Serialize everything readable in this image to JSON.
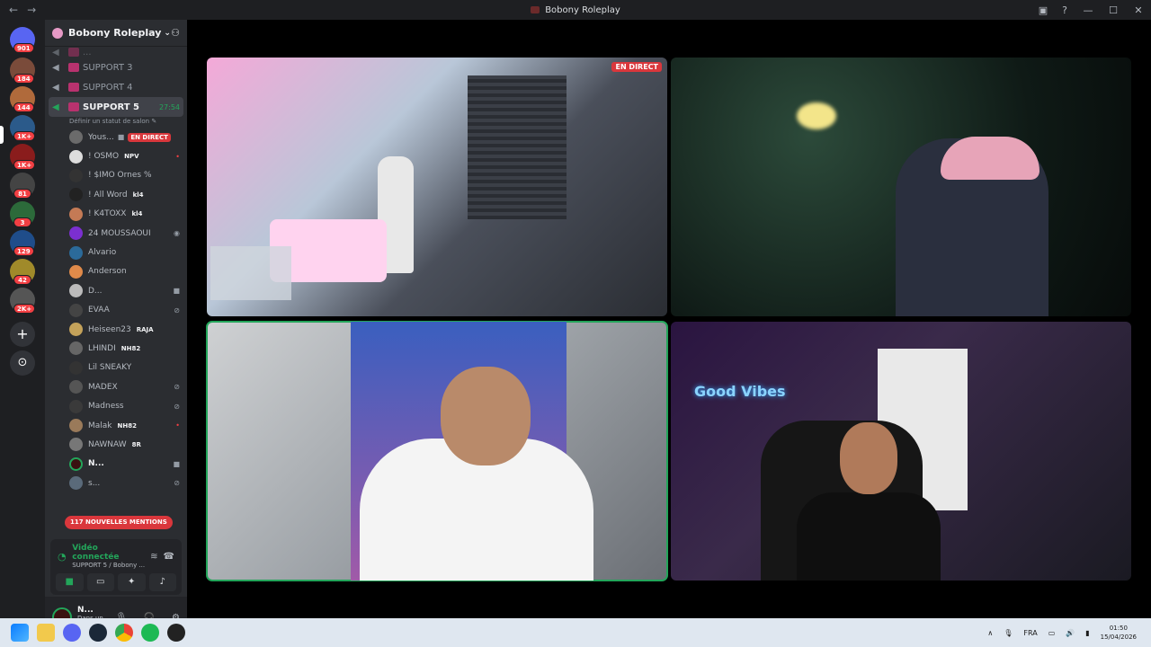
{
  "window": {
    "title": "Bobony Roleplay",
    "back_icon": "arrow-left-icon",
    "forward_icon": "arrow-right-icon"
  },
  "guilds": [
    {
      "name": "discord-home",
      "badge": "901",
      "color": "#5865f2"
    },
    {
      "name": "guild-1",
      "badge": "184",
      "color": "#7a4b3a"
    },
    {
      "name": "guild-2",
      "badge": "144",
      "color": "#b06a3b"
    },
    {
      "name": "guild-3",
      "badge": "1K+",
      "color": "#2b5a8a"
    },
    {
      "name": "guild-4",
      "badge": "1K+",
      "color": "#8a1c1c"
    },
    {
      "name": "guild-5",
      "badge": "81",
      "color": "#444"
    },
    {
      "name": "guild-6",
      "badge": "3",
      "color": "#2c6a3a"
    },
    {
      "name": "guild-7",
      "badge": "129",
      "color": "#1f4d8a"
    },
    {
      "name": "guild-8",
      "badge": "42",
      "color": "#a08a2a"
    },
    {
      "name": "guild-9",
      "badge": "2K+",
      "color": "#555"
    }
  ],
  "server": {
    "name": "Bobony Roleplay",
    "channels": [
      {
        "label": "SUPPORT 3"
      },
      {
        "label": "SUPPORT 4"
      }
    ],
    "active_channel": {
      "label": "SUPPORT 5",
      "time": "27:54",
      "subtitle": "Définir un statut de salon"
    },
    "members": [
      {
        "name": "Yous...",
        "extra": "",
        "live": "EN DIRECT",
        "color": "#6b6b6b"
      },
      {
        "name": "! OSMO",
        "extra": "NPV",
        "live": "",
        "color": "#ddd"
      },
      {
        "name": "! $IMO Ornes %",
        "extra": "",
        "live": "",
        "color": "#333"
      },
      {
        "name": "! All Word",
        "extra": "kl4",
        "live": "",
        "color": "#222"
      },
      {
        "name": "! K4TOXX",
        "extra": "kl4",
        "live": "",
        "color": "#c47a55"
      },
      {
        "name": "24 MOUSSAOUI",
        "extra": "",
        "live": "",
        "color": "#7b2fd0"
      },
      {
        "name": "Alvario",
        "extra": "",
        "live": "",
        "color": "#2b6a9a"
      },
      {
        "name": "Anderson",
        "extra": "",
        "live": "",
        "color": "#e08a4a"
      },
      {
        "name": "D...",
        "extra": "",
        "live": "",
        "color": "#bbb"
      },
      {
        "name": "EVAA",
        "extra": "",
        "live": "",
        "color": "#444"
      },
      {
        "name": "Heiseen23",
        "extra": "RAJA",
        "live": "",
        "color": "#c4a25a"
      },
      {
        "name": "LHINDI",
        "extra": "NH82",
        "live": "",
        "color": "#666"
      },
      {
        "name": "Lil SNEAKY",
        "extra": "",
        "live": "",
        "color": "#333"
      },
      {
        "name": "MADEX",
        "extra": "",
        "live": "",
        "color": "#555"
      },
      {
        "name": "Madness",
        "extra": "",
        "live": "",
        "color": "#3a3a3a"
      },
      {
        "name": "Malak",
        "extra": "NH82",
        "live": "",
        "color": "#9a7a5a"
      },
      {
        "name": "NAWNAW",
        "extra": "8R",
        "live": "",
        "color": "#777"
      },
      {
        "name": "N...",
        "extra": "",
        "live": "",
        "color": "#3a1111"
      },
      {
        "name": "s...",
        "extra": "",
        "live": "",
        "color": "#5a6a7a"
      }
    ],
    "mentions": "117 NOUVELLES MENTIONS"
  },
  "voice": {
    "status": "Vidéo connectée",
    "channel": "SUPPORT 5 / Bobony ..."
  },
  "user": {
    "name": "N...",
    "status": "Dans un sa"
  },
  "stage": {
    "live_label": "EN DIRECT",
    "neon_text": "Good Vibes"
  },
  "taskbar": {
    "lang": "FRA",
    "time": "01:50",
    "date": "15/04/2026"
  }
}
